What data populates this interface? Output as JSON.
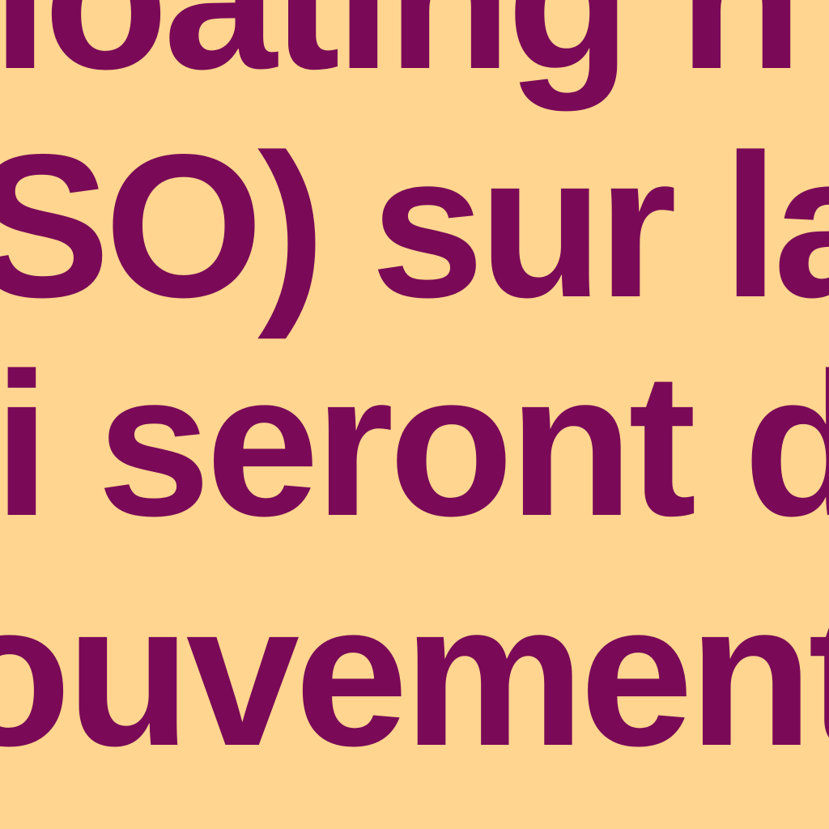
{
  "document": {
    "lines": [
      "loating  n",
      "SO) sur la v",
      "li seront  d",
      "ouvement"
    ]
  },
  "colors": {
    "background": "#FFD58F",
    "text": "#7A0A57"
  }
}
